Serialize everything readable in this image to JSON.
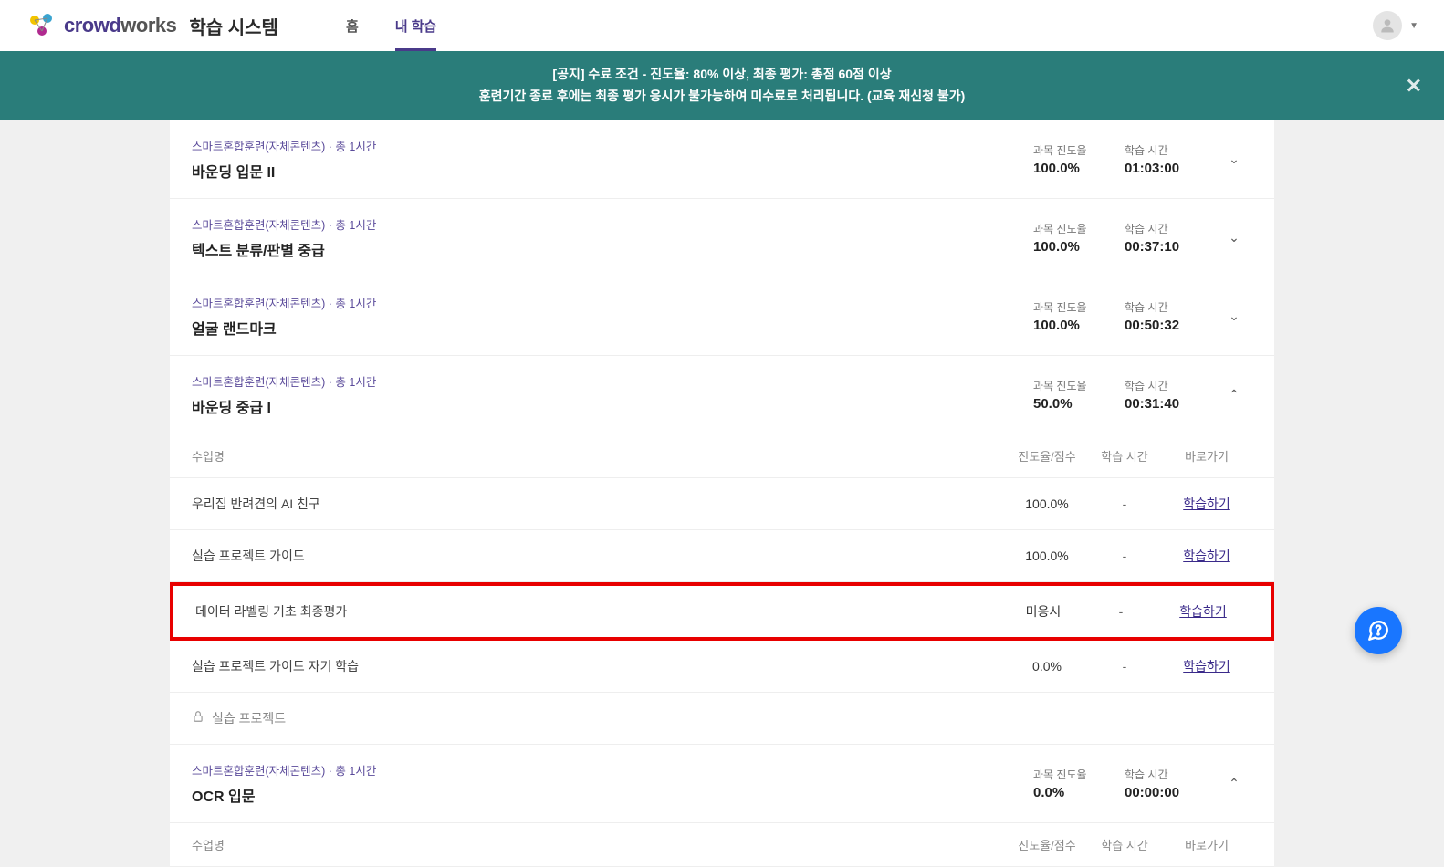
{
  "header": {
    "brand_main": "crowd",
    "brand_sub": "works",
    "brand_suffix": "학습 시스템",
    "nav_home": "홈",
    "nav_mylearning": "내 학습"
  },
  "banner": {
    "line1": "[공지] 수료 조건 - 진도율: 80% 이상, 최종 평가: 총점 60점 이상",
    "line2": "훈련기간 종료 후에는 최종 평가 응시가 불가능하여 미수료로 처리됩니다. (교육 재신청 불가)"
  },
  "labels": {
    "category": "스마트혼합훈련(자체콘텐츠) · 총 1시간",
    "progress_label": "과목 진도율",
    "time_label": "학습 시간",
    "sub_name": "수업명",
    "sub_progress": "진도율/점수",
    "sub_time": "학습 시간",
    "sub_link": "바로가기",
    "learn_link": "학습하기",
    "locked_project": "실습 프로젝트"
  },
  "courses": [
    {
      "title": "바운딩 입문 II",
      "progress": "100.0%",
      "time": "01:03:00",
      "expanded": false
    },
    {
      "title": "텍스트 분류/판별 중급",
      "progress": "100.0%",
      "time": "00:37:10",
      "expanded": false
    },
    {
      "title": "얼굴 랜드마크",
      "progress": "100.0%",
      "time": "00:50:32",
      "expanded": false
    },
    {
      "title": "바운딩 중급 I",
      "progress": "50.0%",
      "time": "00:31:40",
      "expanded": true
    },
    {
      "title": "OCR 입문",
      "progress": "0.0%",
      "time": "00:00:00",
      "expanded": true
    }
  ],
  "sub_rows": [
    {
      "name": "우리집 반려견의 AI 친구",
      "progress": "100.0%",
      "time": "-",
      "highlight": false
    },
    {
      "name": "실습 프로젝트 가이드",
      "progress": "100.0%",
      "time": "-",
      "highlight": false
    },
    {
      "name": "데이터 라벨링 기초 최종평가",
      "progress": "미응시",
      "time": "-",
      "highlight": true
    },
    {
      "name": "실습 프로젝트 가이드 자기 학습",
      "progress": "0.0%",
      "time": "-",
      "highlight": false
    }
  ]
}
